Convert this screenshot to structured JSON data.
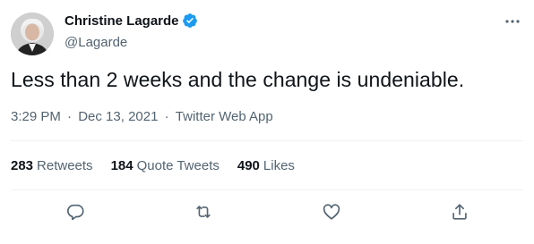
{
  "author": {
    "name": "Christine Lagarde",
    "handle": "@Lagarde",
    "verified": true
  },
  "tweet": {
    "text": "Less than 2 weeks and the change is undeniable.",
    "time": "3:29 PM",
    "date": "Dec 13, 2021",
    "source": "Twitter Web App",
    "separator": "·"
  },
  "stats": [
    {
      "count": "283",
      "label": "Retweets"
    },
    {
      "count": "184",
      "label": "Quote Tweets"
    },
    {
      "count": "490",
      "label": "Likes"
    }
  ],
  "icons": {
    "more": "more-dots-icon",
    "reply": "reply-icon",
    "retweet": "retweet-icon",
    "like": "heart-icon",
    "share": "share-icon",
    "verified": "verified-badge-icon"
  },
  "colors": {
    "text": "#0f1419",
    "secondary": "#536471",
    "verified": "#1d9bf0",
    "divider": "#eff3f4"
  }
}
